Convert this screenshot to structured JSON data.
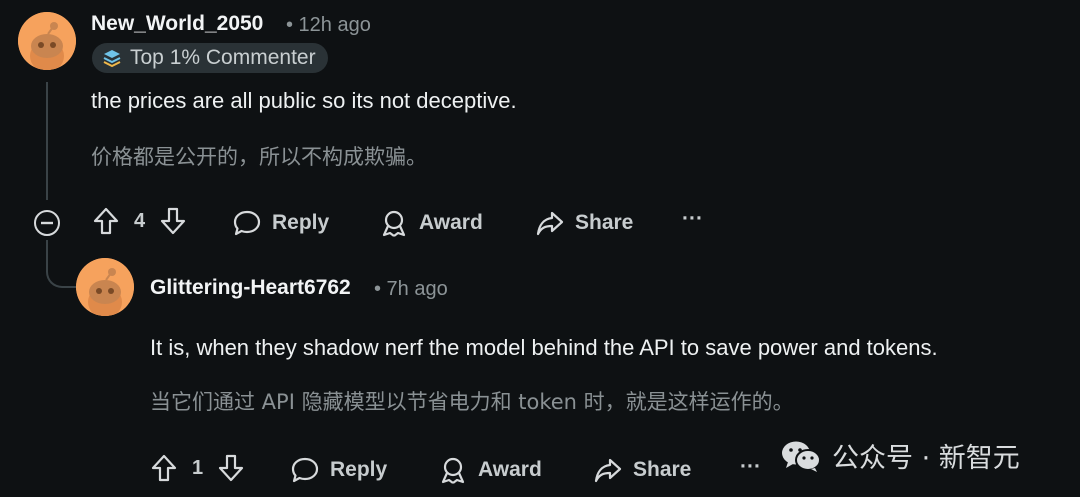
{
  "comment1": {
    "username": "New_World_2050",
    "time": "• 12h ago",
    "badge": "Top 1% Commenter",
    "text_en": "the prices are all public so its not deceptive.",
    "text_zh": "价格都是公开的，所以不构成欺骗。",
    "votes": "4",
    "reply": "Reply",
    "award": "Award",
    "share": "Share",
    "more": "···"
  },
  "comment2": {
    "username": "Glittering-Heart6762",
    "time": "• 7h ago",
    "text_en": "It is, when they shadow nerf the model behind the API to save power and tokens.",
    "text_zh": "当它们通过 API 隐藏模型以节省电力和 token 时，就是这样运作的。",
    "votes": "1",
    "reply": "Reply",
    "award": "Award",
    "share": "Share",
    "more": "···"
  },
  "watermark": {
    "text": "公众号 · 新智元"
  },
  "colors": {
    "background": "#0e1113",
    "avatar": "#f6a25d",
    "badge_bg": "#2a3236"
  }
}
